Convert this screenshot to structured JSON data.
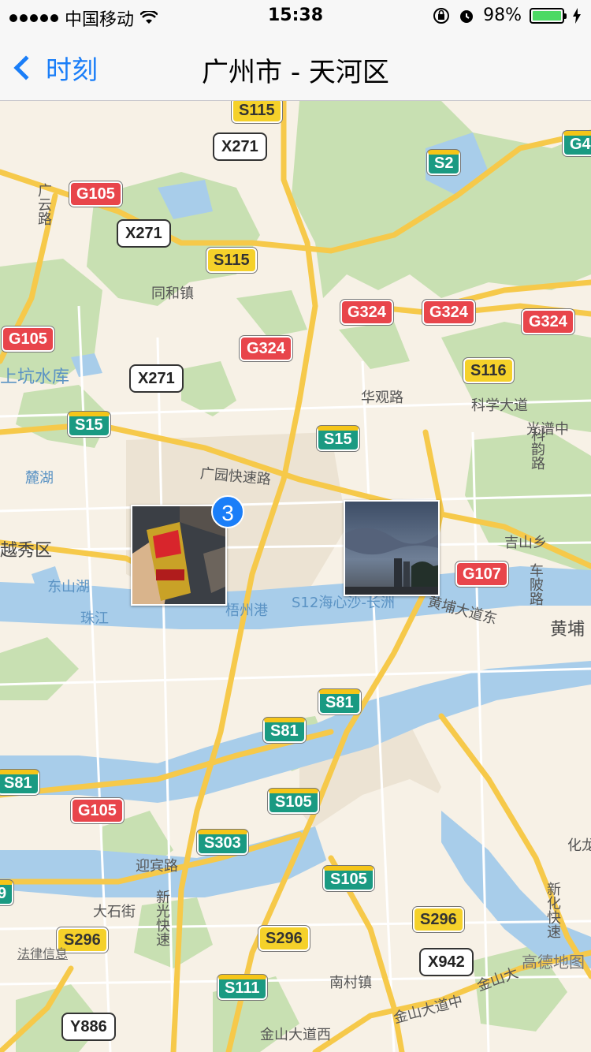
{
  "status_bar": {
    "carrier": "中国移动",
    "time": "15:38",
    "battery": "98%"
  },
  "nav": {
    "back_label": "时刻",
    "title": "广州市 - 天河区"
  },
  "map": {
    "shields": [
      {
        "text": "S115",
        "kind": "sy"
      },
      {
        "text": "X271",
        "kind": "x"
      },
      {
        "text": "G4",
        "kind": "s"
      },
      {
        "text": "S2",
        "kind": "s"
      },
      {
        "text": "G105",
        "kind": "g"
      },
      {
        "text": "X271",
        "kind": "x"
      },
      {
        "text": "S115",
        "kind": "sy"
      },
      {
        "text": "G324",
        "kind": "g"
      },
      {
        "text": "G324",
        "kind": "g"
      },
      {
        "text": "G324",
        "kind": "g"
      },
      {
        "text": "G105",
        "kind": "g"
      },
      {
        "text": "G324",
        "kind": "g"
      },
      {
        "text": "S116",
        "kind": "sy"
      },
      {
        "text": "X271",
        "kind": "x"
      },
      {
        "text": "S15",
        "kind": "s"
      },
      {
        "text": "S15",
        "kind": "s"
      },
      {
        "text": "G107",
        "kind": "g"
      },
      {
        "text": "S81",
        "kind": "s"
      },
      {
        "text": "S81",
        "kind": "s"
      },
      {
        "text": "S81",
        "kind": "s"
      },
      {
        "text": "G105",
        "kind": "g"
      },
      {
        "text": "S105",
        "kind": "s"
      },
      {
        "text": "S303",
        "kind": "s"
      },
      {
        "text": "S105",
        "kind": "s"
      },
      {
        "text": "S296",
        "kind": "sy"
      },
      {
        "text": "S296",
        "kind": "sy"
      },
      {
        "text": "S296",
        "kind": "sy"
      },
      {
        "text": "X942",
        "kind": "x"
      },
      {
        "text": "S111",
        "kind": "s"
      },
      {
        "text": "Y886",
        "kind": "x"
      },
      {
        "text": "9",
        "kind": "s"
      }
    ],
    "labels": [
      "同和镇",
      "上坑水库",
      "华观路",
      "科学大道",
      "光谱中",
      "广园快速路",
      "麓湖",
      "越秀区",
      "东山湖",
      "珠江",
      "吉山乡",
      "黄埔大道东",
      "黄埔",
      "S12海心沙-长洲",
      "梧州港",
      "迎宾路",
      "大石街",
      "南村镇",
      "金山大道中",
      "金山大道西",
      "化龙",
      "广云路",
      "科韵路",
      "新光快速",
      "新化快速",
      "车陂路",
      "金山大"
    ],
    "cluster_count": "3",
    "attribution": "法律信息",
    "logo": "高德地图"
  }
}
